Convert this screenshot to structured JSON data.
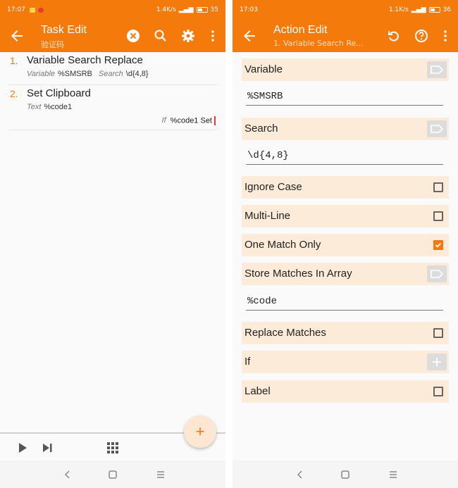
{
  "left": {
    "status": {
      "time": "17:07",
      "speed": "1.4K/s",
      "battery": "35"
    },
    "appbar": {
      "title": "Task Edit",
      "subtitle": "验证码"
    },
    "tasks": [
      {
        "num": "1.",
        "name": "Variable Search Replace",
        "p1_label": "Variable",
        "p1_value": "%SMSRB",
        "p2_label": "Search",
        "p2_value": "\\d{4,8}"
      },
      {
        "num": "2.",
        "name": "Set Clipboard",
        "p1_label": "Text",
        "p1_value": "%code1",
        "cond_label": "If",
        "cond_value": "%code1 Set"
      }
    ],
    "fab_label": "+"
  },
  "right": {
    "status": {
      "time": "17:03",
      "speed": "1.1K/s",
      "battery": "36"
    },
    "appbar": {
      "title": "Action Edit",
      "subtitle": "1. Variable Search Re..."
    },
    "fields": {
      "variable_label": "Variable",
      "variable_value": "%SMSRB",
      "search_label": "Search",
      "search_value": "\\d{4,8}",
      "ignore_case_label": "Ignore Case",
      "multi_line_label": "Multi-Line",
      "one_match_label": "One Match Only",
      "store_matches_label": "Store Matches In Array",
      "store_matches_value": "%code",
      "replace_matches_label": "Replace Matches",
      "if_label": "If",
      "label_label": "Label"
    },
    "checkbox_states": {
      "ignore_case": false,
      "multi_line": false,
      "one_match_only": true,
      "replace_matches": false,
      "label": false
    }
  },
  "colors": {
    "accent": "#f57a0c",
    "row_bg": "#fdebd9"
  }
}
